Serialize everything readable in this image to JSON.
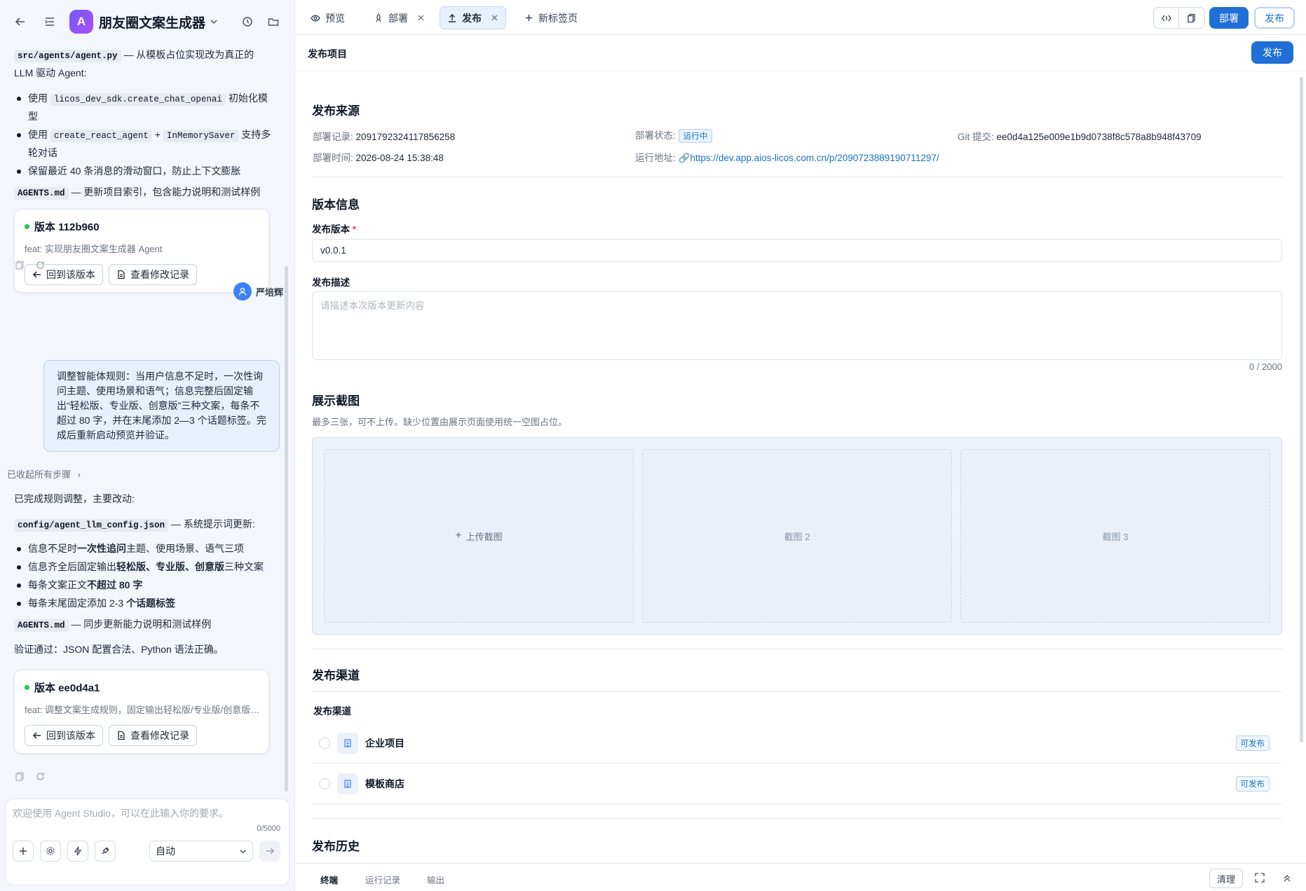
{
  "app": {
    "logo_letter": "A",
    "title": "朋友圈文案生成器"
  },
  "chat": {
    "msg1_file": "src/agents/agent.py",
    "msg1_text_a": " — 从模板占位实现改为真正的",
    "msg1_text_b": "LLM 驱动 Agent:",
    "msg1_b1_a": "使用 ",
    "msg1_b1_code": "licos_dev_sdk.create_chat_openai",
    "msg1_b1_b": " 初始化模",
    "msg1_b1_c": "型",
    "msg1_b2_a": "使用 ",
    "msg1_b2_code1": "create_react_agent",
    "msg1_b2_plus": " + ",
    "msg1_b2_code2": "InMemorySaver",
    "msg1_b2_b": " 支持多",
    "msg1_b2_c": "轮对话",
    "msg1_b3": "保留最近 40 条消息的滑动窗口，防止上下文膨胀",
    "msg1_agents": "AGENTS.md",
    "msg1_agents_text": " — 更新项目索引，包含能力说明和测试样例",
    "version1": {
      "title": "版本 112b960",
      "desc": "feat: 实现朋友圈文案生成器 Agent",
      "revert": "回到该版本",
      "log": "查看修改记录"
    },
    "user_name": "严培辉",
    "user_msg": "调整智能体规则：当用户信息不足时，一次性询问主题、使用场景和语气；信息完整后固定输出“轻松版、专业版、创意版”三种文案，每条不超过 80 字，并在末尾添加 2—3 个话题标签。完成后重新启动预览并验证。",
    "steps_collapsed": "已收起所有步骤",
    "msg2_intro": "已完成规则调整，主要改动:",
    "msg2_file": "config/agent_llm_config.json",
    "msg2_file_text": " — 系统提示词更新:",
    "msg2_b1_a": "信息不足时",
    "msg2_b1_bold": "一次性追问",
    "msg2_b1_b": "主题、使用场景、语气三项",
    "msg2_b2_a": "信息齐全后固定输出",
    "msg2_b2_bold": "轻松版、专业版、创意版",
    "msg2_b2_b": "三种文案",
    "msg2_b3_a": "每条文案正文",
    "msg2_b3_bold": "不超过 80 字",
    "msg2_b4_a": "每条末尾固定添加 2-3 ",
    "msg2_b4_bold": "个话题标签",
    "msg2_agents": "AGENTS.md",
    "msg2_agents_text": " — 同步更新能力说明和测试样例",
    "msg2_verify": "验证通过：JSON 配置合法、Python 语法正确。",
    "version2": {
      "title": "版本 ee0d4a1",
      "desc": "feat: 调整文案生成规则，固定输出轻松版/专业版/创意版三种文案",
      "revert": "回到该版本",
      "log": "查看修改记录"
    }
  },
  "composer": {
    "placeholder": "欢迎使用 Agent Studio，可以在此输入你的要求。",
    "count": "0/5000",
    "mode": "自动"
  },
  "tabs": [
    {
      "label": "预览"
    },
    {
      "label": "部署"
    },
    {
      "label": "发布"
    },
    {
      "label": "新标签页"
    }
  ],
  "topright": {
    "deploy": "部署",
    "publish": "发布"
  },
  "page": {
    "title": "发布项目",
    "publish_button": "发布"
  },
  "source": {
    "heading": "发布来源",
    "record_label": "部署记录:",
    "record_value": "2091792324117856258",
    "status_label": "部署状态:",
    "status_value": "运行中",
    "git_label": "Git 提交:",
    "git_value": "ee0d4a125e009e1b9d0738f8c578a8b948f43709",
    "time_label": "部署时间:",
    "time_value": "2026-08-24 15:38:48",
    "url_label": "运行地址:",
    "url_value": "https://dev.app.aios-licos.com.cn/p/2090723889190711297/"
  },
  "version": {
    "heading": "版本信息",
    "version_label": "发布版本",
    "version_value": "v0.0.1",
    "desc_label": "发布描述",
    "desc_placeholder": "请描述本次版本更新内容",
    "desc_count": "0 / 2000"
  },
  "screenshots": {
    "heading": "展示截图",
    "hint": "最多三张，可不上传。缺少位置由展示页面使用统一空图占位。",
    "upload": "上传截图",
    "slot2": "截图 2",
    "slot3": "截图 3"
  },
  "channels": {
    "heading": "发布渠道",
    "sublabel": "发布渠道",
    "items": [
      {
        "name": "企业项目",
        "status": "可发布"
      },
      {
        "name": "模板商店",
        "status": "可发布"
      }
    ]
  },
  "history": {
    "heading": "发布历史"
  },
  "bottom": {
    "tabs": [
      "终端",
      "运行记录",
      "输出"
    ],
    "clear": "清理"
  }
}
